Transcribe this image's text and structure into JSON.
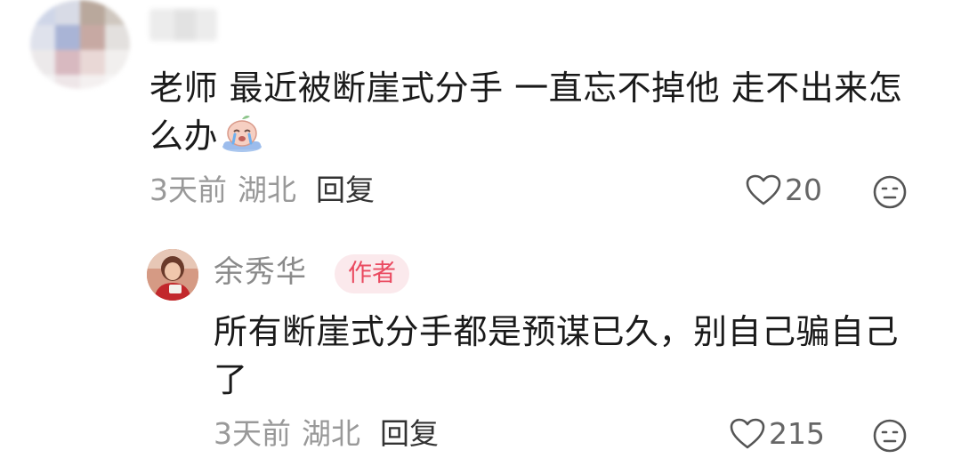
{
  "comment": {
    "text": "老师 最近被断崖式分手 一直忘不掉他 走不出来怎么办",
    "time": "3天前",
    "region": "湖北",
    "reply_label": "回复",
    "like_count": "20",
    "emoji": "crying-peach-emoji"
  },
  "reply": {
    "author_name": "余秀华",
    "author_badge": "作者",
    "text": "所有断崖式分手都是预谋已久，别自己骗自己了",
    "time": "3天前",
    "region": "湖北",
    "reply_label": "回复",
    "like_count": "215"
  },
  "colors": {
    "meta_gray": "#999999",
    "badge_bg": "#fbe9ec",
    "badge_text": "#ea4a60"
  }
}
